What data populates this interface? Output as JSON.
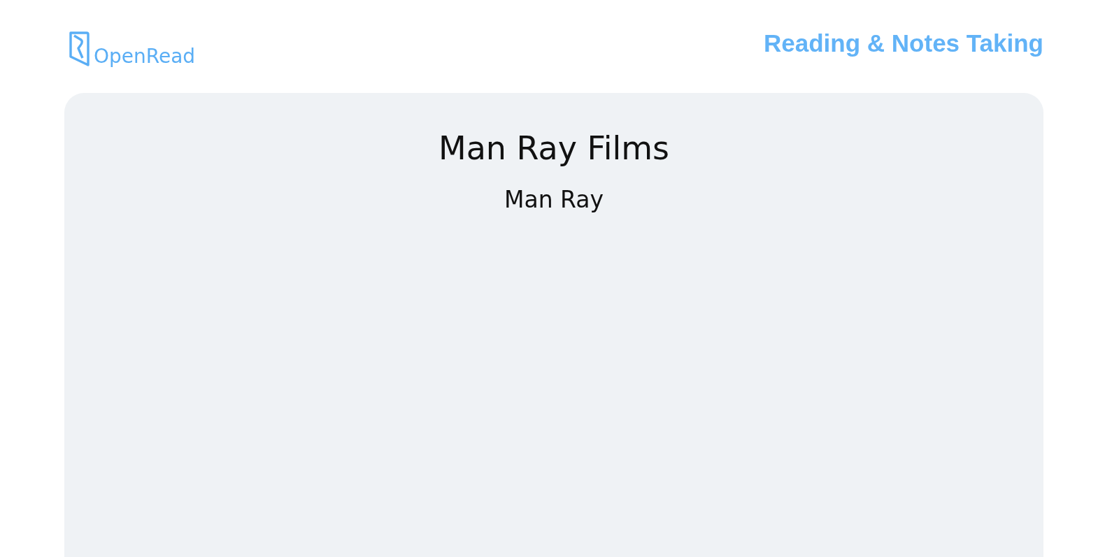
{
  "header": {
    "logo_text": "OpenRead",
    "tagline": "Reading & Notes Taking"
  },
  "book": {
    "title": "Man Ray Films",
    "author": "Man Ray"
  }
}
